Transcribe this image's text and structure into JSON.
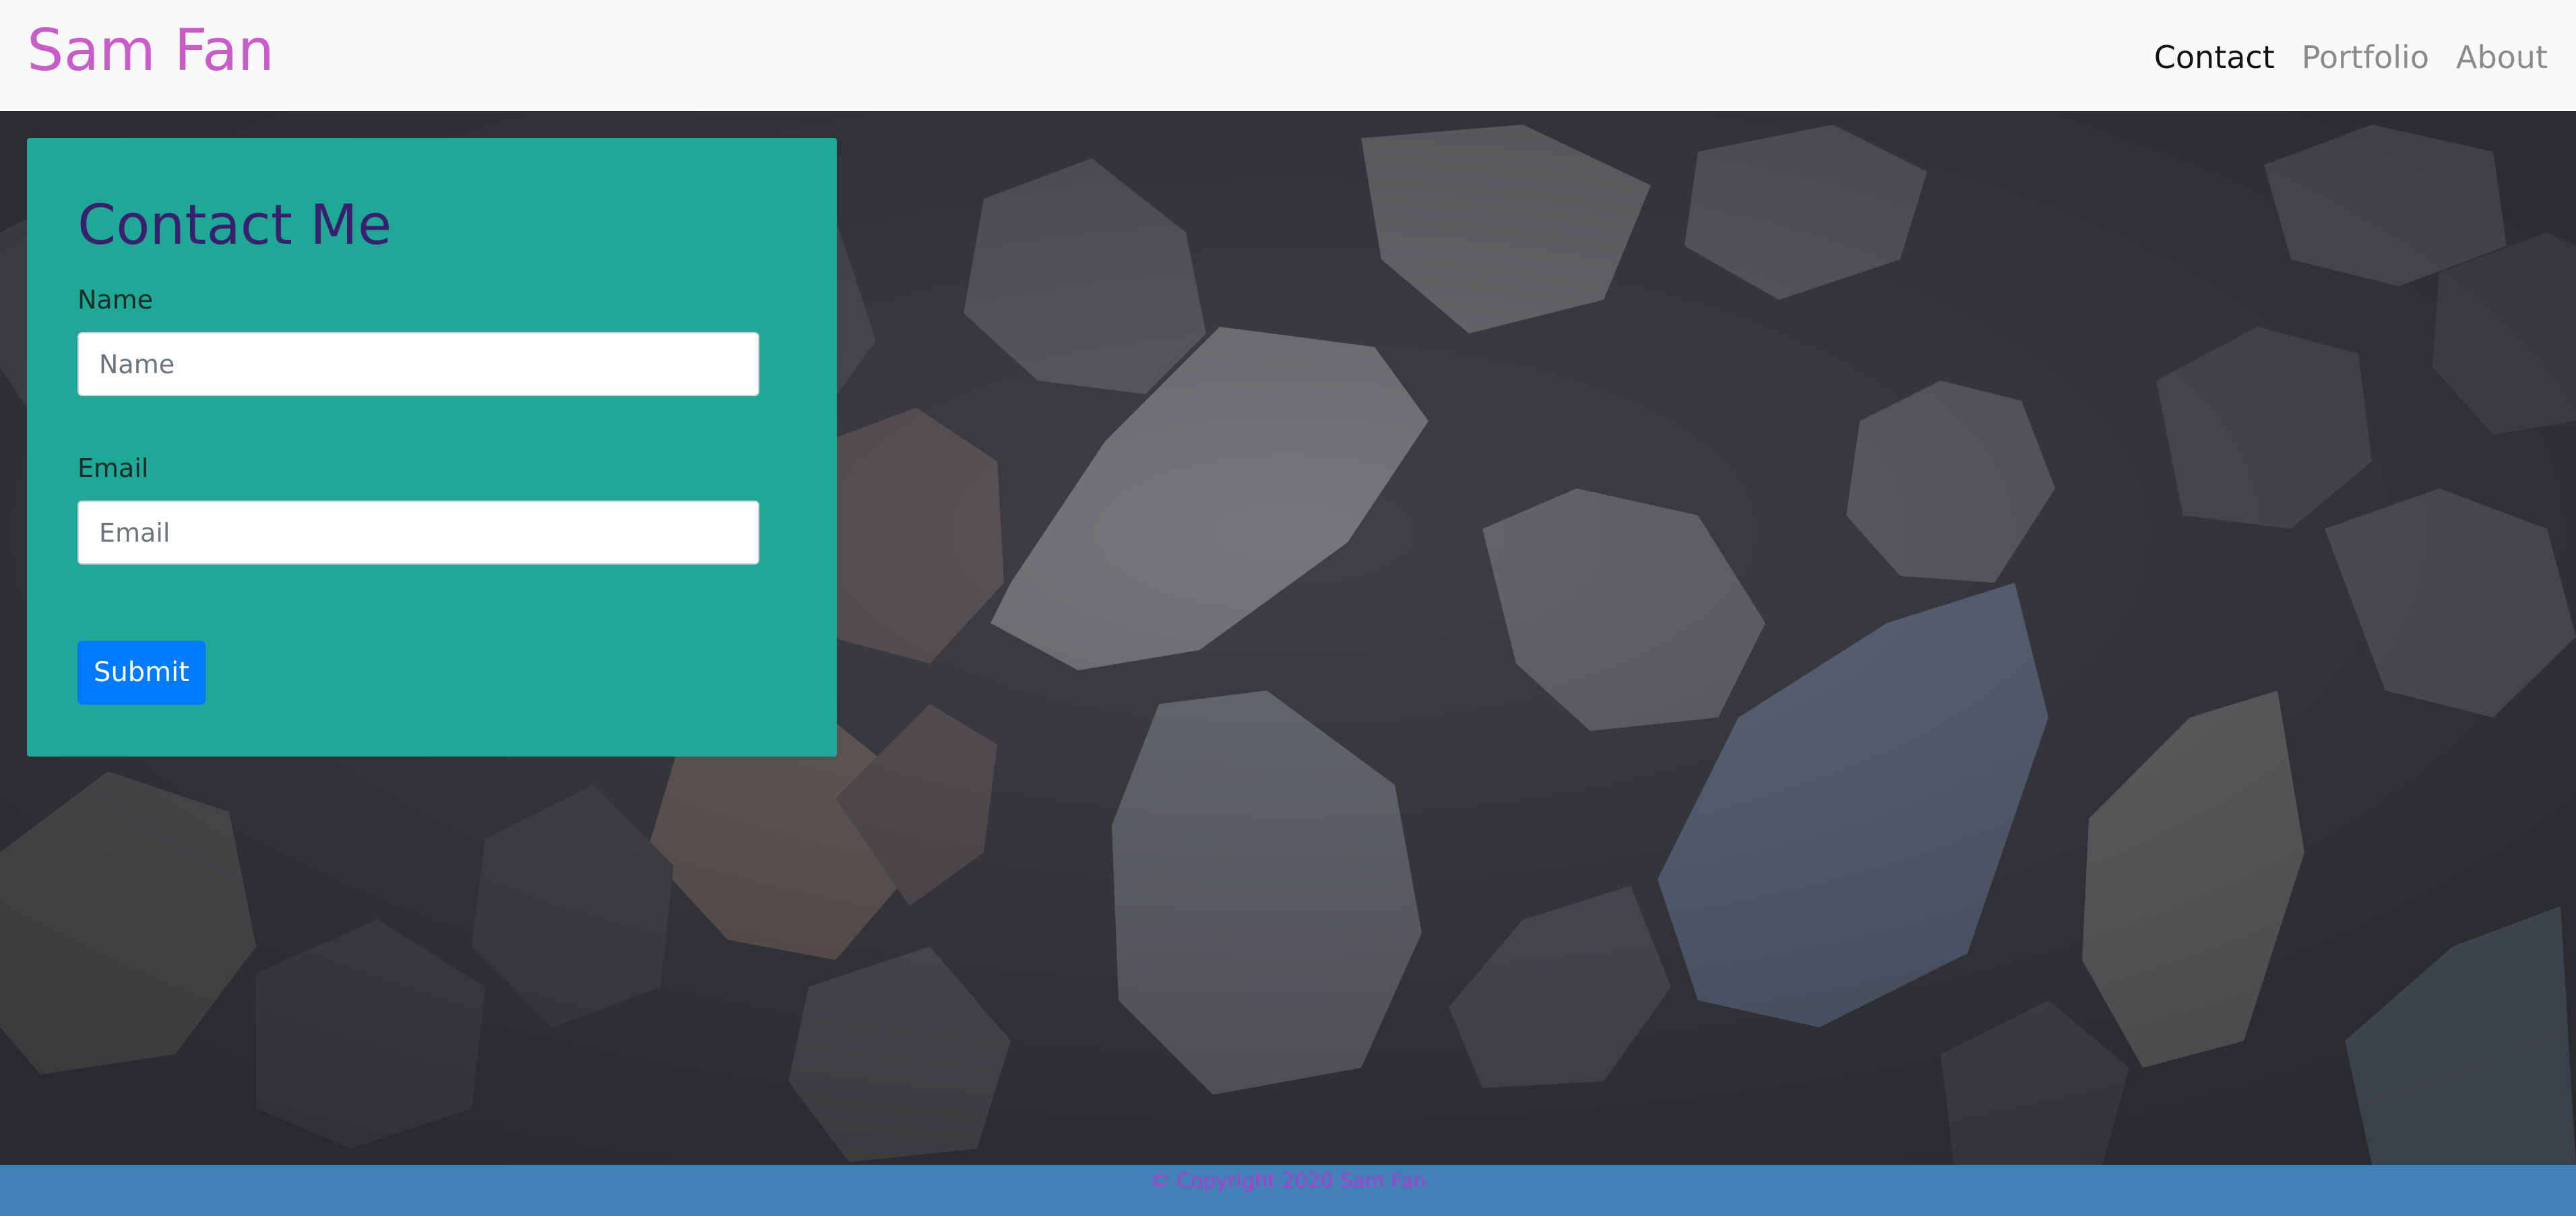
{
  "navbar": {
    "brand": "Sam Fan",
    "links": [
      {
        "label": "Contact",
        "active": true
      },
      {
        "label": "Portfolio",
        "active": false
      },
      {
        "label": "About",
        "active": false
      }
    ]
  },
  "contact_form": {
    "title": "Contact Me",
    "name_label": "Name",
    "name_placeholder": "Name",
    "name_value": "",
    "email_label": "Email",
    "email_placeholder": "Email",
    "email_value": "",
    "submit_label": "Submit"
  },
  "footer": {
    "text": "© Copyright 2020 Sam Fan"
  },
  "colors": {
    "navbar_bg": "#f8f9fa",
    "brand": "#c95cc9",
    "card_bg": "#1fa896",
    "title": "#3a1f6e",
    "button": "#007bff",
    "footer_bg": "#4281b6",
    "footer_text": "#b13bd0"
  }
}
